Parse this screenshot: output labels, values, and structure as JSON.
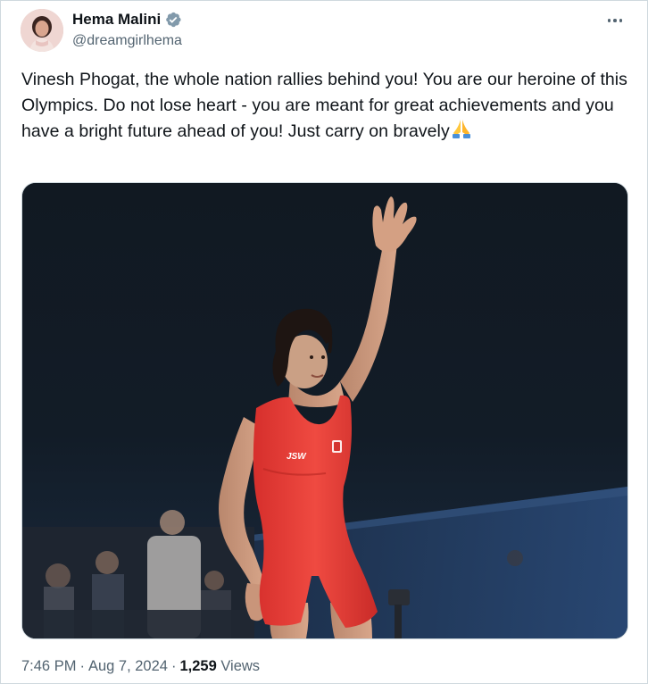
{
  "tweet": {
    "author_name": "Hema Malini",
    "author_handle": "@dreamgirlhema",
    "text": "Vinesh Phogat, the whole nation rallies behind you! You are our heroine of this Olympics. Do not lose heart - you are meant for great achievements and you have a bright future ahead of you! Just carry on bravely",
    "emoji": "folded-hands-emoji",
    "time": "7:46 PM",
    "date": "Aug 7, 2024",
    "separator": "·",
    "views_count": "1,259",
    "views_label": "Views"
  },
  "media": {
    "jersey_logo_text": "JSW"
  },
  "icons": {
    "verified": "verified-badge-icon",
    "more": "more-options-icon"
  },
  "colors": {
    "text_primary": "#0f1419",
    "text_secondary": "#536471",
    "verified_badge": "#829aab",
    "border": "#cfd9de",
    "singlet_red": "#e53a35"
  }
}
